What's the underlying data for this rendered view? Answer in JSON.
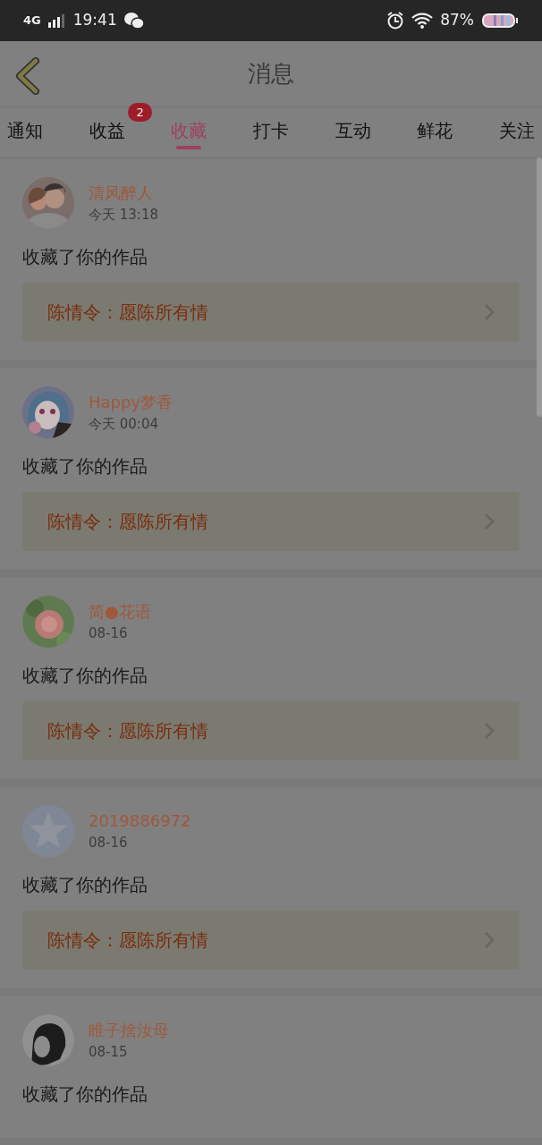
{
  "status_bar": {
    "network": "4G",
    "time": "19:41",
    "battery": "87%"
  },
  "header": {
    "title": "消息"
  },
  "tabs": [
    {
      "label": "通知",
      "selected": false
    },
    {
      "label": "收益",
      "selected": false,
      "badge": "2"
    },
    {
      "label": "收藏",
      "selected": true
    },
    {
      "label": "打卡",
      "selected": false
    },
    {
      "label": "互动",
      "selected": false
    },
    {
      "label": "鲜花",
      "selected": false
    },
    {
      "label": "关注",
      "selected": false
    }
  ],
  "messages": [
    {
      "name": "清风醉人",
      "time": "今天 13:18",
      "text": "收藏了你的作品",
      "work": "陈情令：愿陈所有情"
    },
    {
      "name": "Happy梦香",
      "time": "今天 00:04",
      "text": "收藏了你的作品",
      "work": "陈情令：愿陈所有情"
    },
    {
      "name": "简●花语",
      "time": "08-16",
      "text": "收藏了你的作品",
      "work": "陈情令：愿陈所有情"
    },
    {
      "name": "2019886972",
      "time": "08-16",
      "text": "收藏了你的作品",
      "work": "陈情令：愿陈所有情"
    },
    {
      "name": "睢子捨汝母",
      "time": "08-15",
      "text": "收藏了你的作品"
    }
  ]
}
